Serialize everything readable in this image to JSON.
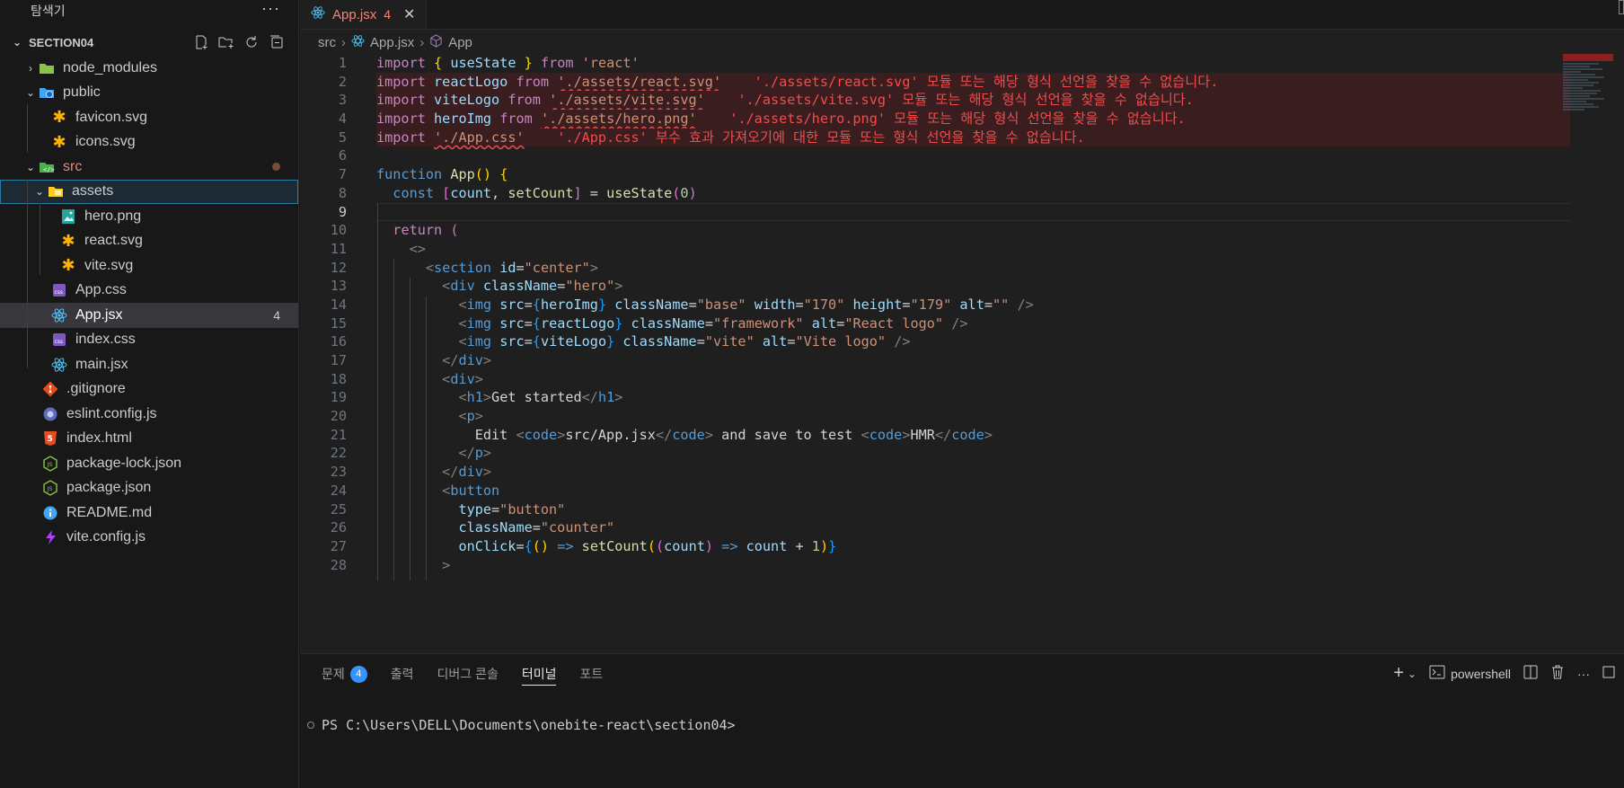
{
  "explorer": {
    "title": "탐색기",
    "more": "···",
    "section": "SECTION04",
    "items": [
      {
        "label": "node_modules",
        "type": "folder",
        "depth": 0,
        "chev": "›"
      },
      {
        "label": "public",
        "type": "folder",
        "depth": 0,
        "chev": "⌄"
      },
      {
        "label": "favicon.svg",
        "type": "svg",
        "depth": 1
      },
      {
        "label": "icons.svg",
        "type": "svg",
        "depth": 1
      },
      {
        "label": "src",
        "type": "folder",
        "depth": 0,
        "chev": "⌄"
      },
      {
        "label": "assets",
        "type": "folder",
        "depth": 1,
        "chev": "⌄"
      },
      {
        "label": "hero.png",
        "type": "png",
        "depth": 2
      },
      {
        "label": "react.svg",
        "type": "svg",
        "depth": 2
      },
      {
        "label": "vite.svg",
        "type": "svg",
        "depth": 2
      },
      {
        "label": "App.css",
        "type": "css",
        "depth": 1
      },
      {
        "label": "App.jsx",
        "type": "jsx",
        "depth": 1,
        "badge": "4"
      },
      {
        "label": "index.css",
        "type": "css",
        "depth": 1
      },
      {
        "label": "main.jsx",
        "type": "jsx",
        "depth": 1
      },
      {
        "label": ".gitignore",
        "type": "git",
        "depth": 0
      },
      {
        "label": "eslint.config.js",
        "type": "eslint",
        "depth": 0
      },
      {
        "label": "index.html",
        "type": "html",
        "depth": 0
      },
      {
        "label": "package-lock.json",
        "type": "json",
        "depth": 0
      },
      {
        "label": "package.json",
        "type": "json",
        "depth": 0
      },
      {
        "label": "README.md",
        "type": "info",
        "depth": 0
      },
      {
        "label": "vite.config.js",
        "type": "vite",
        "depth": 0
      }
    ]
  },
  "editor": {
    "tab": {
      "label": "App.jsx",
      "problems": "4",
      "close": "✕"
    },
    "breadcrumb": {
      "folder": "src",
      "file": "App.jsx",
      "symbol": "App"
    },
    "line_numbers": [
      "1",
      "2",
      "3",
      "4",
      "5",
      "6",
      "7",
      "8",
      "9",
      "10",
      "11",
      "12",
      "13",
      "14",
      "15",
      "16",
      "17",
      "18",
      "19",
      "20",
      "21",
      "22",
      "23",
      "24",
      "25",
      "26",
      "27",
      "28"
    ],
    "errors": {
      "l2": "'./assets/react.svg' 모듈 또는 해당 형식 선언을 찾을 수 없습니다.",
      "l3": "'./assets/vite.svg' 모듈 또는 해당 형식 선언을 찾을 수 없습니다.",
      "l4": "'./assets/hero.png' 모듈 또는 해당 형식 선언을 찾을 수 없습니다.",
      "l5": "'./App.css' 부수 효과 가져오기에 대한 모듈 또는 형식 선언을 찾을 수 없습니다."
    }
  },
  "panel": {
    "tabs": {
      "problems": "문제",
      "problems_count": "4",
      "output": "출력",
      "debug": "디버그 콘솔",
      "terminal": "터미널",
      "ports": "포트"
    },
    "shell": "powershell",
    "prompt": "PS C:\\Users\\DELL\\Documents\\onebite-react\\section04>"
  },
  "colors": {
    "accent": "#0078d4",
    "error": "#f14c4c",
    "badge": "#3794ff"
  }
}
